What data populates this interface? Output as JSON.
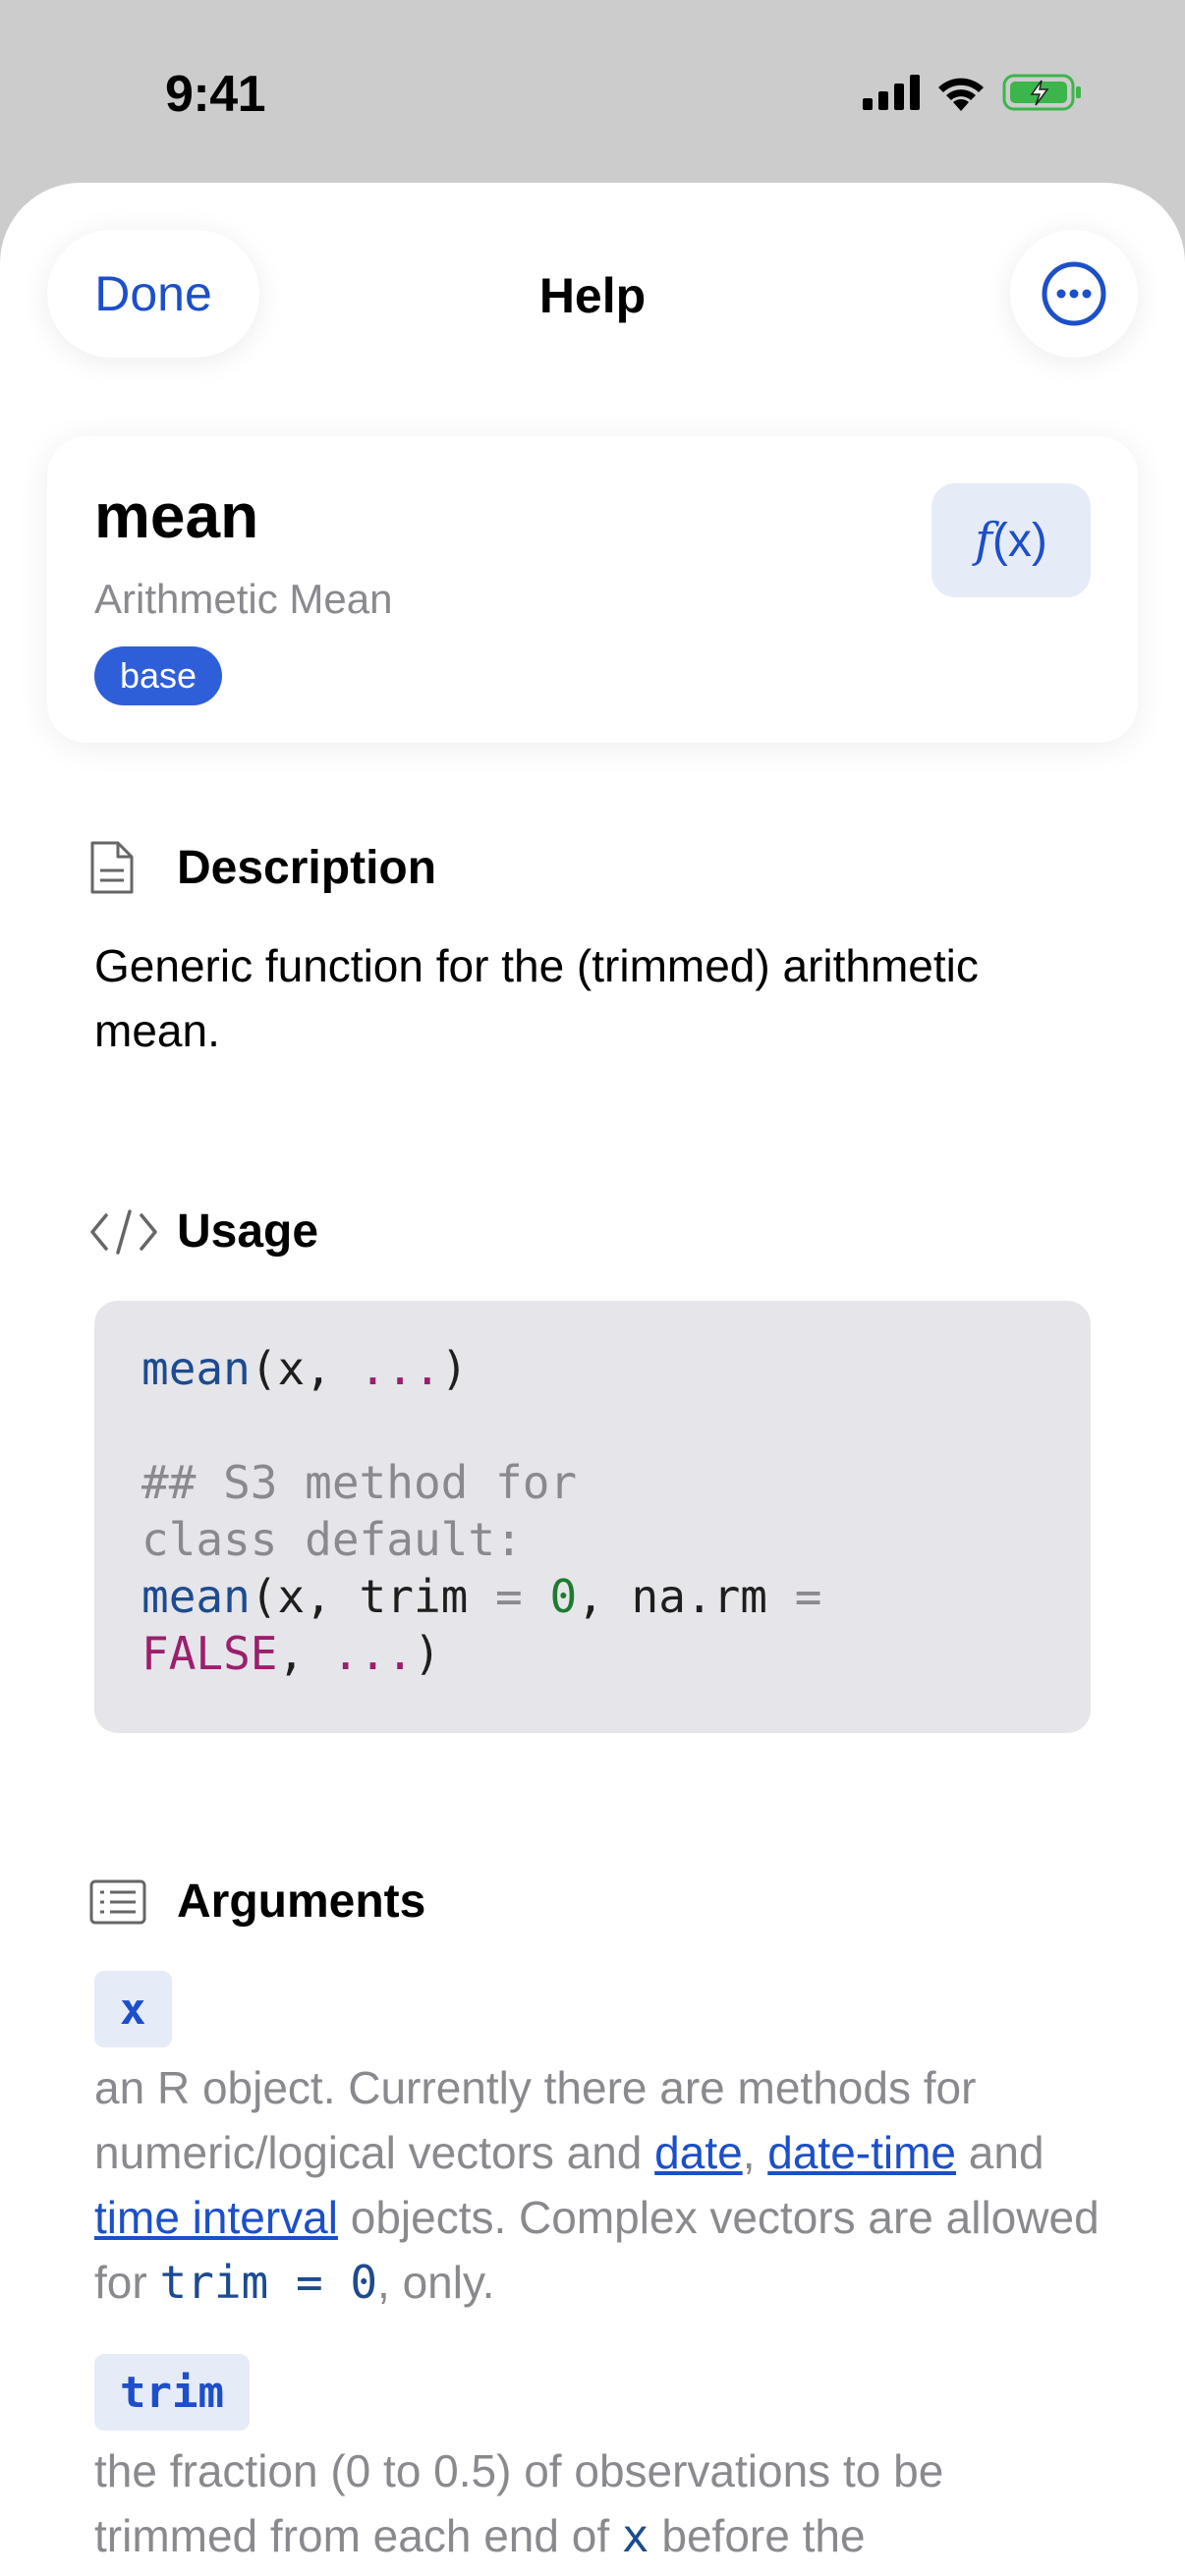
{
  "status_bar": {
    "time": "9:41"
  },
  "nav": {
    "done_label": "Done",
    "title": "Help"
  },
  "function": {
    "name": "mean",
    "title": "Arithmetic Mean",
    "package": "base",
    "fx_label_f": "f",
    "fx_label_x": "(x)"
  },
  "sections": {
    "description": {
      "heading": "Description",
      "text": "Generic function for the (trimmed) arithmetic mean."
    },
    "usage": {
      "heading": "Usage",
      "lines": {
        "l1_fn": "mean",
        "l1_open": "(x, ",
        "l1_dots": "...",
        "l1_close": ")",
        "l2": "## S3 method for",
        "l3": "class default:",
        "l4_fn": "mean",
        "l4_a": "(x, trim ",
        "l4_eq": "=",
        "l4_num": "0",
        "l4_b": ", na.rm ",
        "l4_eq2": "=",
        "l5_kw": "FALSE",
        "l5_a": ", ",
        "l5_dots": "...",
        "l5_close": ")"
      }
    },
    "arguments": {
      "heading": "Arguments",
      "items": [
        {
          "name": "x",
          "desc_a": "an R object. Currently there are methods for numeric/logical vectors and ",
          "link1": "date",
          "desc_b": ", ",
          "link2": "date-time",
          "desc_c": " and ",
          "link3": "time interval",
          "desc_d": " objects. Complex vectors are allowed for ",
          "code": "trim = 0",
          "desc_e": ", only."
        },
        {
          "name": "trim",
          "desc_a": "the fraction (0 to 0.5) of observations to be trimmed from each end of ",
          "code": "x",
          "desc_b": " before the"
        }
      ]
    }
  },
  "colors": {
    "accent": "#1c4fc9",
    "badge": "#2f5fd8",
    "code_bg": "#e5e5ea",
    "muted": "#8a8a8e"
  },
  "icons": [
    "signal-icon",
    "wifi-icon",
    "battery-icon",
    "ellipsis-circle-icon",
    "document-icon",
    "code-icon",
    "list-icon"
  ]
}
